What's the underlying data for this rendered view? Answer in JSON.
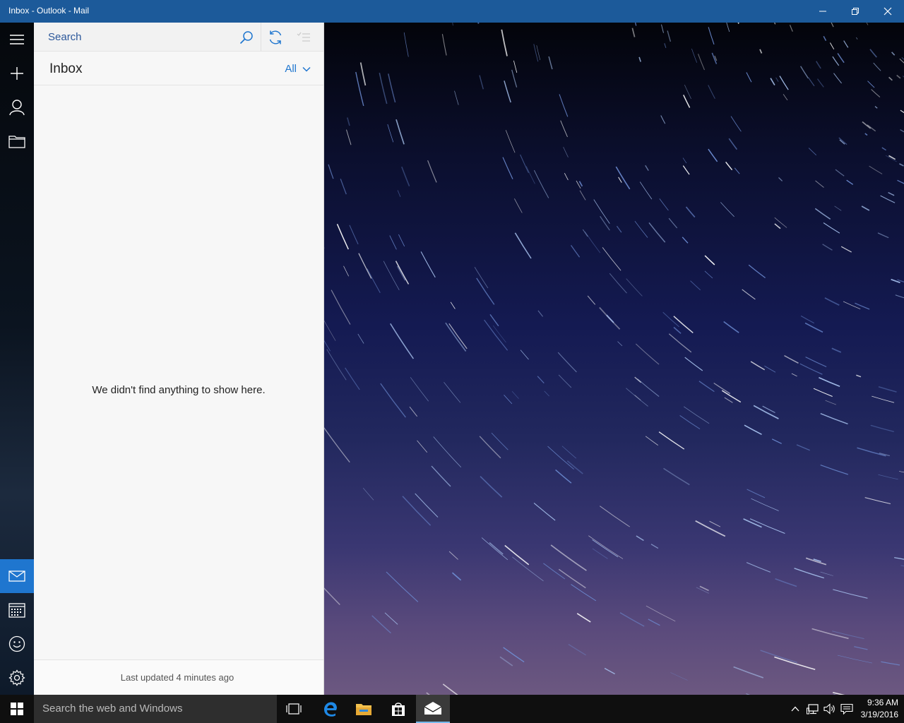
{
  "window": {
    "title": "Inbox - Outlook - Mail"
  },
  "navrail": {
    "items": [
      {
        "icon": "hamburger-icon"
      },
      {
        "icon": "plus-icon"
      },
      {
        "icon": "person-icon"
      },
      {
        "icon": "folder-icon"
      },
      {
        "icon": "mail-icon",
        "active": true
      },
      {
        "icon": "calendar-icon"
      },
      {
        "icon": "smiley-icon"
      },
      {
        "icon": "gear-icon"
      }
    ]
  },
  "listpane": {
    "search_placeholder": "Search",
    "folder_title": "Inbox",
    "filter_label": "All",
    "empty_message": "We didn't find anything to show here.",
    "footer_status": "Last updated 4 minutes ago"
  },
  "taskbar": {
    "search_placeholder": "Search the web and Windows",
    "time": "9:36 AM",
    "date": "3/19/2016"
  },
  "colors": {
    "titlebar": "#1c5a9a",
    "accent": "#1f76cf",
    "taskbar": "#0f0f0f"
  }
}
